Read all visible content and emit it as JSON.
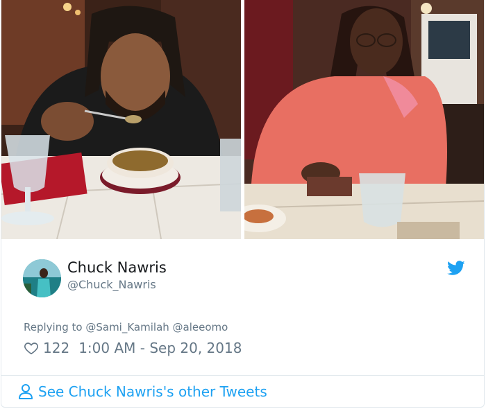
{
  "tweet": {
    "display_name": "Chuck Nawris",
    "handle": "@Chuck_Nawris",
    "reply_prefix": "Replying to",
    "reply_mentions": [
      "@Sami_Kamilah",
      "@aleeomo"
    ],
    "likes": "122",
    "timestamp": "1:00 AM - Sep 20, 2018"
  },
  "footer": {
    "see_more_label": "See Chuck Nawris's other Tweets"
  },
  "colors": {
    "accent": "#1da1f2",
    "secondary_text": "#657786",
    "primary_text": "#14171a",
    "border": "#e1e8ed"
  },
  "icons": [
    "twitter-bird-icon",
    "heart-icon",
    "person-icon"
  ]
}
